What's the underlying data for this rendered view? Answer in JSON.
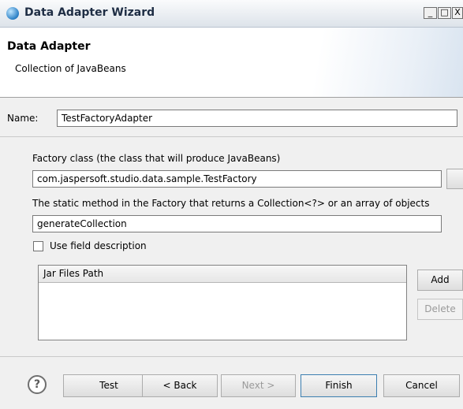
{
  "window": {
    "title": "Data Adapter Wizard",
    "minimize_glyph": "_",
    "maximize_glyph": "□",
    "close_glyph": "X"
  },
  "header": {
    "title": "Data Adapter",
    "subtitle": "Collection of JavaBeans"
  },
  "form": {
    "name_label": "Name:",
    "name_value": "TestFactoryAdapter",
    "factory_label": "Factory class (the class that will produce JavaBeans)",
    "factory_value": "com.jaspersoft.studio.data.sample.TestFactory",
    "method_label": "The static method in the Factory that returns a Collection<?> or an array of objects",
    "method_value": "generateCollection",
    "use_field_description_label": "Use field description",
    "use_field_description_checked": false
  },
  "jar_table": {
    "header": "Jar Files Path",
    "add_label": "Add",
    "delete_label": "Delete"
  },
  "footer": {
    "help_glyph": "?",
    "test_label": "Test",
    "back_label": "< Back",
    "next_label": "Next >",
    "finish_label": "Finish",
    "cancel_label": "Cancel"
  }
}
